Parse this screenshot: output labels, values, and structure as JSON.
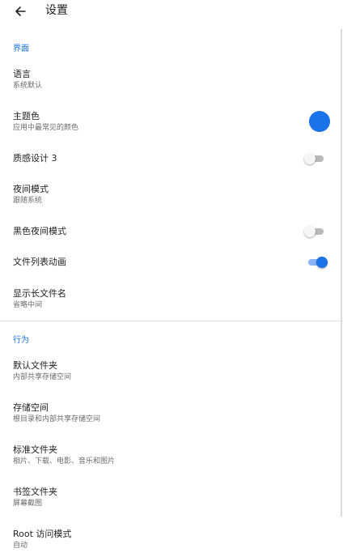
{
  "appbar": {
    "title": "设置"
  },
  "sections": {
    "interface": {
      "header": "界面"
    },
    "behavior": {
      "header": "行为"
    }
  },
  "items": {
    "language": {
      "title": "语言",
      "subtitle": "系统默认"
    },
    "theme_color": {
      "title": "主题色",
      "subtitle": "应用中最常见的颜色",
      "value_color": "#1a73e8"
    },
    "material3": {
      "title": "质感设计 3",
      "enabled": false
    },
    "night_mode": {
      "title": "夜间模式",
      "subtitle": "跟随系统"
    },
    "black_night": {
      "title": "黑色夜间模式",
      "enabled": false
    },
    "file_list_anim": {
      "title": "文件列表动画",
      "enabled": true
    },
    "long_names": {
      "title": "显示长文件名",
      "subtitle": "省略中间"
    },
    "default_folder": {
      "title": "默认文件夹",
      "subtitle": "内部共享存储空间"
    },
    "storage": {
      "title": "存储空间",
      "subtitle": "根目录和内部共享存储空间"
    },
    "standard_dirs": {
      "title": "标准文件夹",
      "subtitle": "相片、下载、电影、音乐和图片"
    },
    "bookmarks": {
      "title": "书签文件夹",
      "subtitle": "屏幕截图"
    },
    "root_mode": {
      "title": "Root 访问模式",
      "subtitle": "自动"
    }
  },
  "colors": {
    "accent": "#1a73e8",
    "accent_track": "#8ab4f8"
  }
}
